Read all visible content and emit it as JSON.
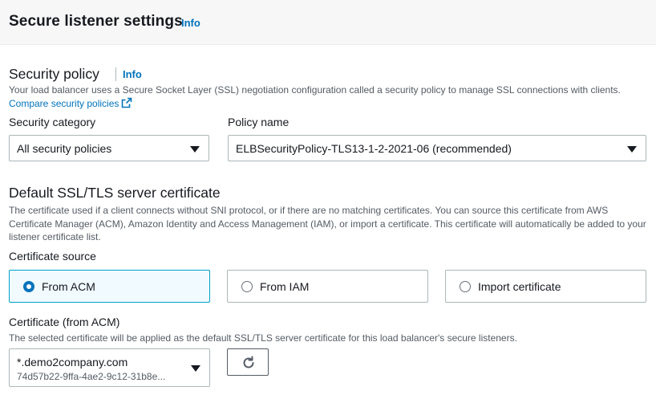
{
  "header": {
    "title": "Secure listener settings",
    "info_label": "Info"
  },
  "security_policy": {
    "title": "Security policy",
    "info_label": "Info",
    "description": "Your load balancer uses a Secure Socket Layer (SSL) negotiation configuration called a security policy to manage SSL connections with clients.",
    "compare_link": "Compare security policies",
    "category_label": "Security category",
    "category_value": "All security policies",
    "policy_label": "Policy name",
    "policy_value": "ELBSecurityPolicy-TLS13-1-2-2021-06 (recommended)"
  },
  "certificate": {
    "title": "Default SSL/TLS server certificate",
    "description": "The certificate used if a client connects without SNI protocol, or if there are no matching certificates. You can source this certificate from AWS Certificate Manager (ACM), Amazon Identity and Access Management (IAM), or import a certificate. This certificate will automatically be added to your listener certificate list.",
    "source_label": "Certificate source",
    "sources": [
      {
        "label": "From ACM",
        "selected": true
      },
      {
        "label": "From IAM",
        "selected": false
      },
      {
        "label": "Import certificate",
        "selected": false
      }
    ],
    "acm_label": "Certificate (from ACM)",
    "acm_description": "The selected certificate will be applied as the default SSL/TLS server certificate for this load balancer's secure listeners.",
    "selected_cert_name": "*.demo2company.com",
    "selected_cert_id": "74d57b22-9ffa-4ae2-9c12-31b8e..."
  },
  "icons": {
    "external": "external-link-icon",
    "refresh": "refresh-icon",
    "caret": "caret-down-icon"
  },
  "colors": {
    "link": "#0073bb",
    "selected_tile_bg": "#f1faff",
    "selected_tile_border": "#00a1c9",
    "header_bg": "#f7f7f7"
  }
}
